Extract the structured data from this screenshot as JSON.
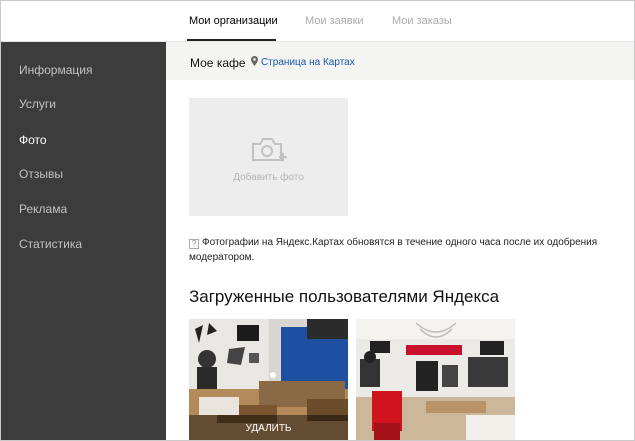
{
  "tabs": [
    {
      "label": "Мои организации",
      "active": true
    },
    {
      "label": "Мои заявки",
      "active": false
    },
    {
      "label": "Мои заказы",
      "active": false
    }
  ],
  "sidebar": {
    "items": [
      {
        "label": "Информация",
        "active": false
      },
      {
        "label": "Услуги",
        "active": false
      },
      {
        "label": "Фото",
        "active": true
      },
      {
        "label": "Отзывы",
        "active": false
      },
      {
        "label": "Реклама",
        "active": false
      },
      {
        "label": "Статистика",
        "active": false
      }
    ]
  },
  "header": {
    "org_name": "Мое кафе",
    "map_link": "Страница на Картах",
    "map_icon": "pin-icon"
  },
  "add_photo": {
    "label": "Добавить фото",
    "icon": "camera-plus-icon"
  },
  "info": {
    "icon": "help-icon",
    "text": "Фотографии на Яндекс.Картах обновятся в течение одного часа после их одобрения модератором."
  },
  "section": {
    "title": "Загруженные пользователями Яндекса"
  },
  "photos": [
    {
      "delete_label": "УДАЛИТЬ"
    }
  ],
  "colors": {
    "sidebar_bg": "#3c3c3c",
    "header_bg": "#f4f4f2",
    "link": "#1a57b0",
    "tile_bg": "#ededed"
  }
}
